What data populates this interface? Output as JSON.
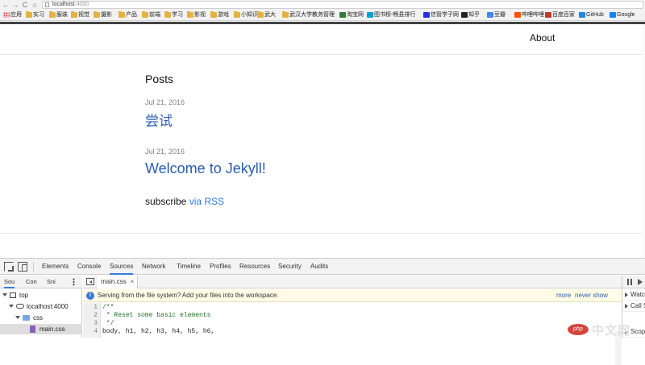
{
  "browser": {
    "url_host": "localhost",
    "url_port": ":4000",
    "bookmarks": [
      {
        "label": "应用",
        "icon": "apps-icon"
      },
      {
        "label": "实习",
        "icon": "folder-icon"
      },
      {
        "label": "服装",
        "icon": "folder-icon"
      },
      {
        "label": "视觉",
        "icon": "folder-icon"
      },
      {
        "label": "摄影",
        "icon": "folder-icon"
      },
      {
        "label": "产品",
        "icon": "folder-icon"
      },
      {
        "label": "前端",
        "icon": "folder-icon"
      },
      {
        "label": "学习",
        "icon": "folder-icon"
      },
      {
        "label": "影视",
        "icon": "folder-icon"
      },
      {
        "label": "游戏",
        "icon": "folder-icon"
      },
      {
        "label": "小知识",
        "icon": "folder-icon"
      },
      {
        "label": "武大",
        "icon": "folder-icon"
      },
      {
        "label": "武汉大学教务管理",
        "icon": "folder-icon"
      },
      {
        "label": "淘宝网",
        "icon": "site-icon"
      },
      {
        "label": "图书榜-畅县排行",
        "icon": "site-icon"
      },
      {
        "label": "信管学子网",
        "icon": "site-icon"
      },
      {
        "label": "知乎",
        "icon": "site-icon"
      },
      {
        "label": "豆瓣",
        "icon": "site-icon"
      },
      {
        "label": "哔哩哔哩",
        "icon": "site-icon"
      },
      {
        "label": "百度百家",
        "icon": "site-icon"
      },
      {
        "label": "GitHub",
        "icon": "github-icon"
      },
      {
        "label": "Google",
        "icon": "google-icon"
      }
    ]
  },
  "site": {
    "nav_about": "About",
    "posts_heading": "Posts",
    "posts": [
      {
        "date": "Jul 21, 2016",
        "title": "尝试"
      },
      {
        "date": "Jul 21, 2016",
        "title": "Welcome to Jekyll!"
      }
    ],
    "subscribe_text": "subscribe ",
    "subscribe_link": "via RSS"
  },
  "devtools": {
    "tabs": [
      "Elements",
      "Console",
      "Sources",
      "Network",
      "Timeline",
      "Profiles",
      "Resources",
      "Security",
      "Audits"
    ],
    "active_tab": "Sources",
    "navigator_tabs": [
      "Sou",
      "Con",
      "Sni"
    ],
    "tree": {
      "top": "top",
      "host": "localhost:4000",
      "folder": "css",
      "file": "main.css"
    },
    "open_file": "main.css",
    "info_message": "Serving from the file system? Add your files into the workspace.",
    "info_more": "more",
    "info_never": "never show",
    "code_lines": [
      {
        "n": "1",
        "text": "/**",
        "kind": "comment"
      },
      {
        "n": "2",
        "text": " * Reset some basic elements",
        "kind": "comment"
      },
      {
        "n": "3",
        "text": " */",
        "kind": "comment"
      },
      {
        "n": "4",
        "text": "body, h1, h2, h3, h4, h5, h6,",
        "kind": "plain"
      }
    ],
    "debug_rows": [
      "Watc",
      "Call S",
      "Scop"
    ]
  },
  "watermark": {
    "logo": "php",
    "text": "中文网"
  },
  "colors": {
    "link": "#2a5db0",
    "rss": "#2a7ae2",
    "date": "#828282",
    "devtools_active": "#3879d9"
  }
}
